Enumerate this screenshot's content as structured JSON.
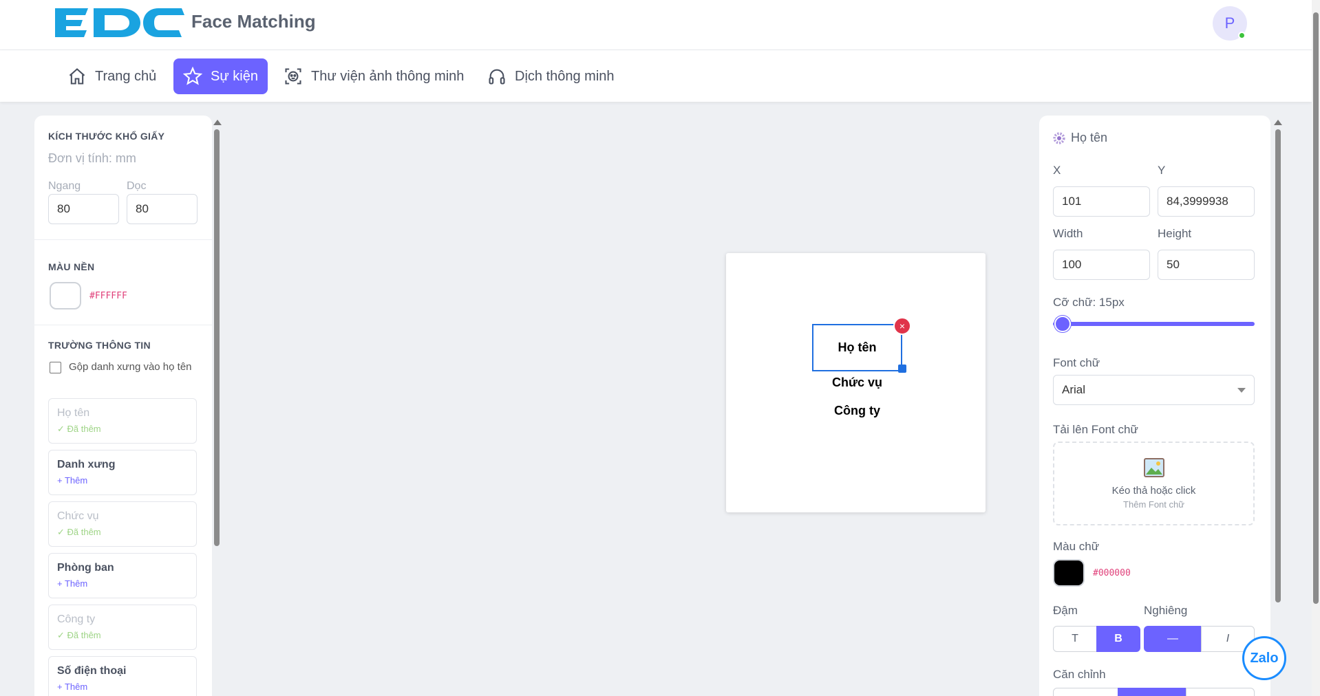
{
  "header": {
    "logo_text": "EDC",
    "app_title": "Face Matching",
    "avatar_initial": "P"
  },
  "nav": {
    "items": [
      {
        "label": "Trang chủ",
        "icon": "home-icon",
        "active": false
      },
      {
        "label": "Sự kiện",
        "icon": "star-icon",
        "active": true
      },
      {
        "label": "Thư viện ảnh thông minh",
        "icon": "face-scan-icon",
        "active": false
      },
      {
        "label": "Dịch thông minh",
        "icon": "headset-icon",
        "active": false
      }
    ]
  },
  "left": {
    "paper_size_title": "KÍCH THƯỚC KHỔ GIẤY",
    "unit_text": "Đơn vị tính: mm",
    "width_label": "Ngang",
    "height_label": "Dọc",
    "width_value": "80",
    "height_value": "80",
    "bg_title": "MÀU NỀN",
    "bg_hex": "#FFFFFF",
    "fields_title": "TRƯỜNG THÔNG TIN",
    "merge_label": "Gộp danh xưng vào họ tên",
    "merge_checked": false,
    "fields": [
      {
        "name": "Họ tên",
        "status": "✓ Đã thêm",
        "added": true
      },
      {
        "name": "Danh xưng",
        "status": "+ Thêm",
        "added": false
      },
      {
        "name": "Chức vụ",
        "status": "✓ Đã thêm",
        "added": true
      },
      {
        "name": "Phòng ban",
        "status": "+ Thêm",
        "added": false
      },
      {
        "name": "Công ty",
        "status": "✓ Đã thêm",
        "added": true
      },
      {
        "name": "Số điện thoại",
        "status": "+ Thêm",
        "added": false
      }
    ]
  },
  "canvas": {
    "elements": [
      "Họ tên",
      "Chức vụ",
      "Công ty"
    ],
    "delete_symbol": "×"
  },
  "right": {
    "title": "Họ tên",
    "x_label": "X",
    "y_label": "Y",
    "x_value": "101",
    "y_value": "84,3999938",
    "w_label": "Width",
    "h_label": "Height",
    "w_value": "100",
    "h_value": "50",
    "font_size_label": "Cỡ chữ: 15px",
    "font_size_value": 15,
    "font_label": "Font chữ",
    "font_value": "Arial",
    "upload_label": "Tải lên Font chữ",
    "upload_main": "Kéo thả hoặc click",
    "upload_sub": "Thêm Font chữ",
    "color_label": "Màu chữ",
    "color_hex": "#000000",
    "bold_label": "Đậm",
    "italic_label": "Nghiêng",
    "bold_opts": [
      "T",
      "B"
    ],
    "italic_opts": [
      "—",
      "I"
    ],
    "align_label": "Căn chỉnh"
  },
  "widget": {
    "zalo": "Zalo"
  },
  "colors": {
    "accent": "#6c63ff",
    "logo": "#1aa3e0",
    "delete": "#e0344a",
    "selection": "#1f6fe0"
  }
}
